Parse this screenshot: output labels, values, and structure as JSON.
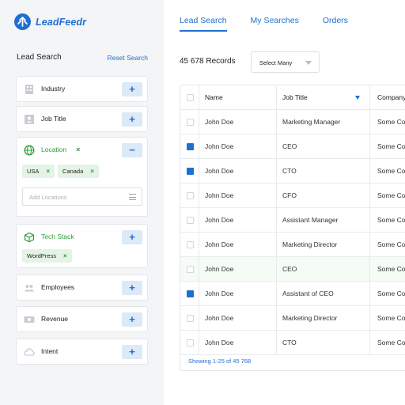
{
  "app": {
    "name": "LeadFeedr"
  },
  "sidebar": {
    "title": "Lead Search",
    "reset_label": "Reset Search",
    "filters": {
      "industry": {
        "label": "Industry",
        "button": "+"
      },
      "job_title": {
        "label": "Job Title",
        "button": "+"
      },
      "location": {
        "label": "Location",
        "button": "−",
        "chips": [
          "USA",
          "Canada"
        ],
        "input_placeholder": "Add Locations"
      },
      "tech_stack": {
        "label": "Tech Stack",
        "button": "+",
        "chips": [
          "WordPress"
        ]
      },
      "employees": {
        "label": "Employees",
        "button": "+"
      },
      "revenue": {
        "label": "Revenue",
        "button": "+"
      },
      "intent": {
        "label": "Intent",
        "button": "+"
      }
    },
    "chip_remove": "×"
  },
  "tabs": [
    "Lead Search",
    "My Searches",
    "Orders"
  ],
  "toolbar": {
    "records": "45 678 Records",
    "select_label": "Select Many"
  },
  "table": {
    "columns": [
      "Name",
      "Job Title",
      "Company"
    ],
    "rows": [
      {
        "name": "John Doe",
        "job": "Marketing Manager",
        "company": "Some Co",
        "checked": false,
        "highlight": false
      },
      {
        "name": "John Doe",
        "job": "CEO",
        "company": "Some Co",
        "checked": true,
        "highlight": false
      },
      {
        "name": "John Doe",
        "job": "CTO",
        "company": "Some Co",
        "checked": true,
        "highlight": false
      },
      {
        "name": "John Doe",
        "job": "CFO",
        "company": "Some Co",
        "checked": false,
        "highlight": false
      },
      {
        "name": "John Doe",
        "job": "Assistant Manager",
        "company": "Some Co",
        "checked": false,
        "highlight": false
      },
      {
        "name": "John Doe",
        "job": "Marketing Director",
        "company": "Some Co",
        "checked": false,
        "highlight": false
      },
      {
        "name": "John Doe",
        "job": "CEO",
        "company": "Some Co",
        "checked": false,
        "highlight": true
      },
      {
        "name": "John Doe",
        "job": "Assistant of CEO",
        "company": "Some Co",
        "checked": true,
        "highlight": false
      },
      {
        "name": "John Doe",
        "job": "Marketing Director",
        "company": "Some Co",
        "checked": false,
        "highlight": false
      },
      {
        "name": "John Doe",
        "job": "CTO",
        "company": "Some Co",
        "checked": false,
        "highlight": false
      }
    ],
    "footer": "Showing 1-25 of 45 768"
  },
  "colors": {
    "accent": "#1f6fd0",
    "green": "#2e9b3a",
    "sidebar_bg": "#f4f5f7"
  }
}
